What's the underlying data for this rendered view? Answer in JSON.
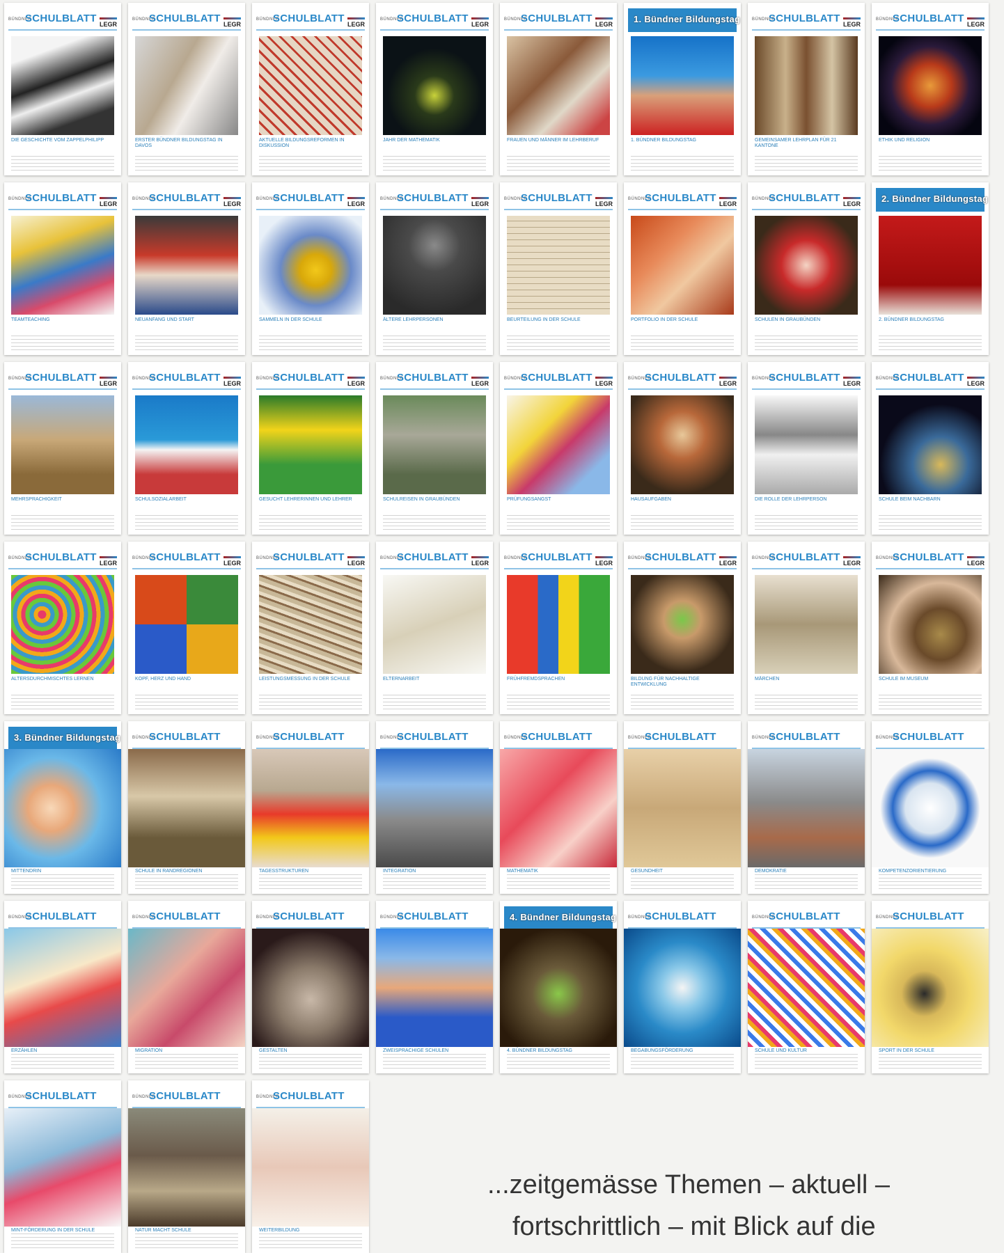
{
  "masthead": {
    "small": "BÜNDNER",
    "big": "SCHULBLATT",
    "legr": "LEGR"
  },
  "covers": [
    {
      "title": "DIE GESCHICHTE VOM ZAPPELPHILIPP",
      "art": "linear-gradient(160deg,#f4f4f4 20%,#222 45%,#eee 60%,#333 80%)"
    },
    {
      "title": "ERSTER BÜNDNER BILDUNGSTAG IN DAVOS",
      "art": "linear-gradient(120deg,#d6d6d6,#b8a890 40%,#f0ece8 60%,#888)"
    },
    {
      "title": "AKTUELLE BILDUNGSREFORMEN IN DISKUSSION",
      "art": "repeating-linear-gradient(45deg,#c0392b 0 3px,#e6d6c4 3px 12px)"
    },
    {
      "title": "JAHR DER MATHEMATIK",
      "art": "radial-gradient(circle at 50% 60%,#c8d23a 0,#2a3a1a 25%,#0b1216 60%)"
    },
    {
      "title": "FRAUEN UND MÄNNER IM LEHRBERUF",
      "art": "linear-gradient(135deg,#d9c2a3,#8a5a3a 40%,#e0d8c8 65%,#c44 90%)"
    },
    {
      "title": "1. BÜNDNER BILDUNGSTAG",
      "art": "linear-gradient(180deg,#1672c8 0%,#3b9ae0 40%,#d9a07a 60%,#c22 100%)",
      "special": "1. Bündner Bildungstag"
    },
    {
      "title": "GEMEINSAMER LEHRPLAN FÜR 21 KANTONE",
      "art": "linear-gradient(90deg,#6b4a2a,#c8b08a 30%,#7a5030 50%,#d4c4a4 75%,#5a3a20)"
    },
    {
      "title": "ETHIK UND RELIGION",
      "art": "radial-gradient(circle,#e89a3a 0,#b83a1a 30%,#2a1a3a 55%,#050510 80%)"
    },
    {
      "title": "TEAMTEACHING",
      "art": "linear-gradient(160deg,#f6f0d0,#e8c23a 30%,#3a7ac8 55%,#d84a6a 75%,#f4f4f4)"
    },
    {
      "title": "NEUANFANG UND START",
      "art": "linear-gradient(180deg,#3a3a3a,#c83a2a 40%,#e8d8c8 60%,#2a4a8a)"
    },
    {
      "title": "SAMMELN IN DER SCHULE",
      "art": "radial-gradient(circle at 55% 55%,#f2c81a 0,#d8a80a 20%,#6a8ac8 45%,#e8f0f8 80%)"
    },
    {
      "title": "ÄLTERE LEHRPERSONEN",
      "art": "radial-gradient(circle at 50% 30%,#8a8a8a 0,#4a4a4a 30%,#2a2a2a 80%)"
    },
    {
      "title": "BEURTEILUNG IN DER SCHULE",
      "art": "repeating-linear-gradient(0deg,#e8dcc4 0 8px,#b8a888 8px 9px)"
    },
    {
      "title": "PORTFOLIO IN DER SCHULE",
      "art": "linear-gradient(135deg,#c84a1a,#e88a5a 35%,#f0c8a0 60%,#a83a1a)"
    },
    {
      "title": "SCHULEN IN GRAUBÜNDEN",
      "art": "radial-gradient(circle,#f4d4c4 0,#c82a2a 35%,#3a2a1a 75%)"
    },
    {
      "title": "2. BÜNDNER BILDUNGSTAG",
      "art": "linear-gradient(180deg,#c41a1a,#9a0a0a 70%,#e8e0d8)",
      "special": "2. Bündner Bildungstag"
    },
    {
      "title": "MEHRSPRACHIGKEIT",
      "art": "linear-gradient(180deg,#9ab8d8 0%,#c8a878 45%,#8a6a3a 80%)"
    },
    {
      "title": "SCHULSOZIALARBEIT",
      "art": "linear-gradient(180deg,#1a7ac8 0%,#2a9ad8 45%,#f4f4f4 55%,#c83a3a 80%)"
    },
    {
      "title": "GESUCHT LEHRERINNEN UND LEHRER",
      "art": "linear-gradient(180deg,#2a7a2a 0%,#f2d41a 35%,#3a9a3a 70%)"
    },
    {
      "title": "SCHULREISEN IN GRAUBÜNDEN",
      "art": "linear-gradient(180deg,#6a8a5a 0%,#a8a898 40%,#5a6a4a 80%)"
    },
    {
      "title": "PRÜFUNGSANGST",
      "art": "linear-gradient(135deg,#f8f4e8,#f2d43a 35%,#c83a6a 55%,#8ab8e8 80%)"
    },
    {
      "title": "HAUSAUFGABEN",
      "art": "radial-gradient(circle at 50% 40%,#e8c89a 0,#b8683a 30%,#3a2a1a 75%)"
    },
    {
      "title": "DIE ROLLE DER LEHRPERSON",
      "art": "linear-gradient(180deg,#f8f8f8,#888 40%,#f0f0f0 60%,#aaa)"
    },
    {
      "title": "SCHULE BEIM NACHBARN",
      "art": "radial-gradient(circle at 60% 70%,#d8b85a 0,#3a6a9a 30%,#0a0a1a 65%)"
    },
    {
      "title": "ALTERSDURCHMISCHTES LERNEN",
      "art": "repeating-radial-gradient(circle at 30% 40%,#e83a6a 0 6px,#f2a81a 6px 12px,#3a9ac8 12px 18px,#6ac83a 18px 24px)"
    },
    {
      "title": "KOPF, HERZ UND HAND",
      "art": "conic-gradient(#3a8a3a 0 25%,#e8a81a 25% 50%,#2a5ac8 50% 75%,#d84a1a 75% 100%)"
    },
    {
      "title": "LEISTUNGSMESSUNG IN DER SCHULE",
      "art": "repeating-linear-gradient(20deg,#c8b898 0 6px,#8a6a4a 6px 9px,#e8dcc4 9px 14px)"
    },
    {
      "title": "ELTERNARBEIT",
      "art": "linear-gradient(160deg,#f8f8f4,#d8d0b8 50%,#f8f8f4)"
    },
    {
      "title": "FRÜHFREMDSPRACHEN",
      "art": "linear-gradient(90deg,#e83a2a 0 30%,#2a6ac8 30% 50%,#f2d41a 50% 70%,#3aa83a 70%)"
    },
    {
      "title": "BILDUNG FÜR NACHHALTIGE ENTWICKLUNG",
      "art": "radial-gradient(circle at 50% 45%,#7ac84a 0,#c89a6a 25%,#3a2a1a 70%)"
    },
    {
      "title": "MÄRCHEN",
      "art": "linear-gradient(180deg,#e8e0d0,#a89878 50%,#d8d0b8)"
    },
    {
      "title": "SCHULE IM MUSEUM",
      "art": "radial-gradient(circle at 60% 60%,#a88a4a 0,#6a4a2a 30%,#d8b89a 60%,#3a2a1a)"
    },
    {
      "title": "MITTENDRIN",
      "art": "radial-gradient(circle at 40% 50%,#f8d8b8 0,#e8a87a 25%,#6ab8e8 55%,#2a7ac8)",
      "newstyle": true,
      "special": "3. Bündner Bildungstag"
    },
    {
      "title": "SCHULE IN RANDREGIONEN",
      "art": "linear-gradient(180deg,#8a6a4a 0%,#d8c8a8 40%,#6a5a3a 75%)",
      "newstyle": true
    },
    {
      "title": "TAGESSTRUKTUREN",
      "art": "linear-gradient(180deg,#d8c8b8 0%,#b8a890 35%,#e83a2a 55%,#f2c81a 75%,#e8dcd0)",
      "newstyle": true
    },
    {
      "title": "INTEGRATION",
      "art": "linear-gradient(180deg,#2a6ac8 0%,#8ab8e8 30%,#8a8a8a 60%,#4a4a4a)",
      "newstyle": true
    },
    {
      "title": "MATHEMATIK",
      "art": "linear-gradient(135deg,#f8a8a8,#e84a5a 40%,#f8d0c8 70%,#c82a3a)",
      "newstyle": true
    },
    {
      "title": "GESUNDHEIT",
      "art": "linear-gradient(180deg,#e8d0a8,#c8a878 50%,#e0c898)",
      "newstyle": true
    },
    {
      "title": "DEMOKRATIE",
      "art": "linear-gradient(180deg,#c8d4e0 0%,#8a8a8a 45%,#a86a4a 75%,#6a6a6a)",
      "newstyle": true
    },
    {
      "title": "KOMPETENZORIENTIERUNG",
      "art": "radial-gradient(circle,#ffffff 0,#d8e4f0 30%,#2a6ac8 45%,#f8f8f8 60%)",
      "newstyle": true
    },
    {
      "title": "ERZÄHLEN",
      "art": "linear-gradient(160deg,#8ac8e8,#f8e8c8 40%,#e84a4a 60%,#3a7ac8)",
      "newstyle": true
    },
    {
      "title": "MIGRATION",
      "art": "linear-gradient(135deg,#6ab8c8,#e8a89a 40%,#c84a6a 65%,#f4d4c4)",
      "newstyle": true
    },
    {
      "title": "GESTALTEN",
      "art": "radial-gradient(circle at 50% 60%,#c8b8a8 0,#8a7a6a 35%,#2a1a1a 75%)",
      "newstyle": true
    },
    {
      "title": "ZWEISPRACHIGE SCHULEN",
      "art": "linear-gradient(180deg,#3a8ae8 0%,#8ab8e8 25%,#e8a87a 50%,#2a5ac8 75%)",
      "newstyle": true
    },
    {
      "title": "4. BÜNDNER BILDUNGSTAG",
      "art": "radial-gradient(circle at 50% 55%,#8ac84a 0,#6a5a3a 30%,#2a1a0a 75%)",
      "newstyle": true,
      "special": "4. Bündner Bildungstag"
    },
    {
      "title": "BEGABUNGSFÖRDERUNG",
      "art": "radial-gradient(circle at 50% 50%,#f4f4f4 0,#8ac8e8 25%,#2a8ac8 55%,#0a4a8a)",
      "newstyle": true
    },
    {
      "title": "SCHULE UND KULTUR",
      "art": "repeating-linear-gradient(45deg,#e83a6a 0 6px,#ffffff 6px 12px,#3a7ae8 12px 18px,#ffffff 18px 24px,#f2a81a 24px 30px)",
      "newstyle": true
    },
    {
      "title": "SPORT IN DER SCHULE",
      "art": "radial-gradient(circle at 45% 55%,#2a2a2a 0,#d8b85a 25%,#f2d86a 50%,#f8f0c8)",
      "newstyle": true
    },
    {
      "title": "MINT-FÖRDERUNG IN DER SCHULE",
      "art": "linear-gradient(160deg,#e8f0f8,#8ab8d8 40%,#e84a6a 60%,#f8f8f8)",
      "newstyle": true
    },
    {
      "title": "NATUR MACHT SCHULE",
      "art": "linear-gradient(180deg,#8a8a7a 0%,#6a5a4a 40%,#b8a888 70%,#4a3a2a)",
      "newstyle": true
    },
    {
      "title": "WEITERBILDUNG",
      "art": "linear-gradient(180deg,#f4f0e8,#e8c8b8 50%,#f8f0e8)",
      "newstyle": true
    }
  ],
  "slogan": {
    "line1": "...zeitgemässe Themen – aktuell –",
    "line2": "fortschrittlich – mit Blick auf die"
  }
}
